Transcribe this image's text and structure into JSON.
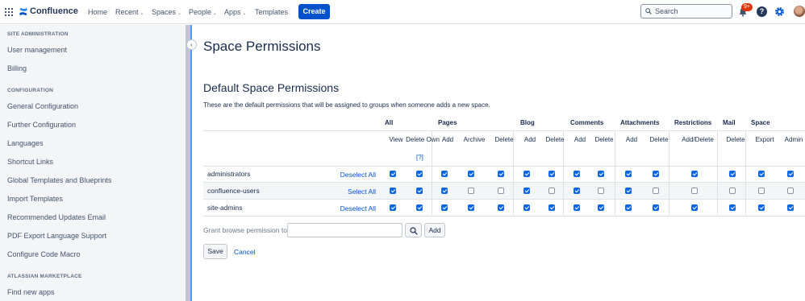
{
  "nav": {
    "app_name": "Confluence",
    "items": [
      {
        "label": "Home",
        "dropdown": false
      },
      {
        "label": "Recent",
        "dropdown": true
      },
      {
        "label": "Spaces",
        "dropdown": true
      },
      {
        "label": "People",
        "dropdown": true
      },
      {
        "label": "Apps",
        "dropdown": true
      },
      {
        "label": "Templates",
        "dropdown": false
      }
    ],
    "create_label": "Create",
    "search_placeholder": "Search",
    "notification_badge": "9+",
    "help_glyph": "?"
  },
  "sidebar": {
    "sections": [
      {
        "heading": "SITE ADMINISTRATION",
        "links": [
          "User management",
          "Billing"
        ]
      },
      {
        "heading": "CONFIGURATION",
        "links": [
          "General Configuration",
          "Further Configuration",
          "Languages",
          "Shortcut Links",
          "Global Templates and Blueprints",
          "Import Templates",
          "Recommended Updates Email",
          "PDF Export Language Support",
          "Configure Code Macro"
        ]
      },
      {
        "heading": "ATLASSIAN MARKETPLACE",
        "links": [
          "Find new apps"
        ]
      }
    ]
  },
  "main": {
    "page_title": "Space Permissions",
    "section_title": "Default Space Permissions",
    "description": "These are the default permissions that will be assigned to groups when someone adds a new space.",
    "group_headers": [
      "All",
      "Pages",
      "Blog",
      "Comments",
      "Attachments",
      "Restrictions",
      "Mail",
      "Space"
    ],
    "columns": [
      "View",
      "Delete Own",
      "Add",
      "Archive",
      "Delete",
      "Add",
      "Delete",
      "Add",
      "Delete",
      "Add",
      "Delete",
      "Add/Delete",
      "Delete",
      "Export",
      "Admin"
    ],
    "delete_own_help": "[?]",
    "rows": [
      {
        "group": "administrators",
        "action": "Deselect All",
        "perms": [
          true,
          true,
          true,
          true,
          true,
          true,
          true,
          true,
          true,
          true,
          true,
          true,
          true,
          true,
          true
        ]
      },
      {
        "group": "confluence-users",
        "action": "Select All",
        "perms": [
          true,
          true,
          true,
          false,
          false,
          true,
          false,
          true,
          false,
          true,
          false,
          false,
          false,
          false,
          false
        ]
      },
      {
        "group": "site-admins",
        "action": "Deselect All",
        "perms": [
          true,
          true,
          true,
          true,
          true,
          true,
          true,
          true,
          true,
          true,
          true,
          true,
          true,
          true,
          true
        ]
      }
    ],
    "grant_label": "Grant browse permission to",
    "grant_input_value": "",
    "add_label": "Add",
    "save_label": "Save",
    "cancel_label": "Cancel"
  },
  "colors": {
    "accent": "#0052cc",
    "checkbox": "#0b66e4",
    "badge": "#de350b"
  }
}
